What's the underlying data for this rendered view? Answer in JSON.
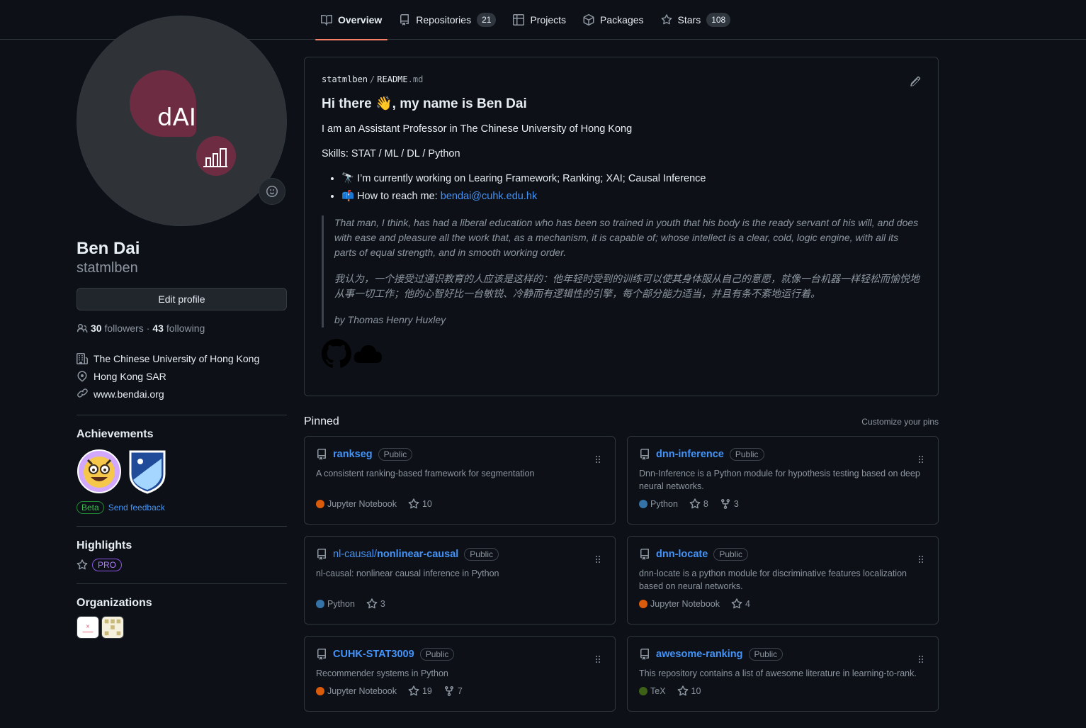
{
  "tabs": [
    {
      "label": "Overview",
      "icon": "book-icon",
      "active": true
    },
    {
      "label": "Repositories",
      "icon": "repo-icon",
      "count": "21"
    },
    {
      "label": "Projects",
      "icon": "table-icon"
    },
    {
      "label": "Packages",
      "icon": "package-icon"
    },
    {
      "label": "Stars",
      "icon": "star-icon",
      "count": "108"
    }
  ],
  "profile": {
    "avatar_text": "dAI",
    "name": "Ben Dai",
    "login": "statmlben",
    "edit_label": "Edit profile",
    "followers_count": "30",
    "followers_label": "followers",
    "separator": "·",
    "following_count": "43",
    "following_label": "following",
    "company": "The Chinese University of Hong Kong",
    "location": "Hong Kong SAR",
    "website": "www.bendai.org"
  },
  "achievements": {
    "title": "Achievements",
    "beta_label": "Beta",
    "feedback_label": "Send feedback"
  },
  "highlights": {
    "title": "Highlights",
    "pro_label": "PRO"
  },
  "organizations": {
    "title": "Organizations"
  },
  "readme": {
    "owner": "statmlben",
    "sep": "/",
    "file": "README",
    "ext": ".md",
    "heading": "Hi there 👋, my name is Ben Dai",
    "intro": "I am an Assistant Professor in The Chinese University of Hong Kong",
    "skills": "Skills: STAT / ML / DL / Python",
    "bullet1": "🔭 I’m currently working on Learing Framework; Ranking; XAI; Causal Inference",
    "bullet2_prefix": "📫 How to reach me: ",
    "bullet2_email": "bendai@cuhk.edu.hk",
    "quote_en": "That man, I think, has had a liberal education who has been so trained in youth that his body is the ready servant of his will, and does with ease and pleasure all the work that, as a mechanism, it is capable of; whose intellect is a clear, cold, logic engine, with all its parts of equal strength, and in smooth working order.",
    "quote_zh": "我认为，一个接受过通识教育的人应该是这样的：他年轻时受到的训练可以使其身体服从自己的意愿，就像一台机器一样轻松而愉悦地从事一切工作；他的心智好比一台敏锐、冷静而有逻辑性的引擎，每个部分能力适当，并且有条不紊地运行着。",
    "quote_by": "by Thomas Henry Huxley"
  },
  "pinned": {
    "title": "Pinned",
    "customize": "Customize your pins",
    "items": [
      {
        "owner": "",
        "name": "rankseg",
        "vis": "Public",
        "desc": "A consistent ranking-based framework for segmentation",
        "lang": "Jupyter Notebook",
        "lang_color": "#DA5B0B",
        "stars": "10",
        "forks": ""
      },
      {
        "owner": "",
        "name": "dnn-inference",
        "vis": "Public",
        "desc": "Dnn-Inference is a Python module for hypothesis testing based on deep neural networks.",
        "lang": "Python",
        "lang_color": "#3572A5",
        "stars": "8",
        "forks": "3"
      },
      {
        "owner": "nl-causal/",
        "name": "nonlinear-causal",
        "vis": "Public",
        "desc": "nl-causal: nonlinear causal inference in Python",
        "lang": "Python",
        "lang_color": "#3572A5",
        "stars": "3",
        "forks": ""
      },
      {
        "owner": "",
        "name": "dnn-locate",
        "vis": "Public",
        "desc": "dnn-locate is a python module for discriminative features localization based on neural networks.",
        "lang": "Jupyter Notebook",
        "lang_color": "#DA5B0B",
        "stars": "4",
        "forks": ""
      },
      {
        "owner": "",
        "name": "CUHK-STAT3009",
        "vis": "Public",
        "desc": "Recommender systems in Python",
        "lang": "Jupyter Notebook",
        "lang_color": "#DA5B0B",
        "stars": "19",
        "forks": "7"
      },
      {
        "owner": "",
        "name": "awesome-ranking",
        "vis": "Public",
        "desc": "This repository contains a list of awesome literature in learning-to-rank.",
        "lang": "TeX",
        "lang_color": "#3D6117",
        "stars": "10",
        "forks": ""
      }
    ]
  },
  "colors": {
    "background": "#0d1117",
    "border": "#30363d",
    "accent": "#4493f8",
    "tab_underline": "#f78166",
    "avatar_logo": "#6e2c43"
  }
}
